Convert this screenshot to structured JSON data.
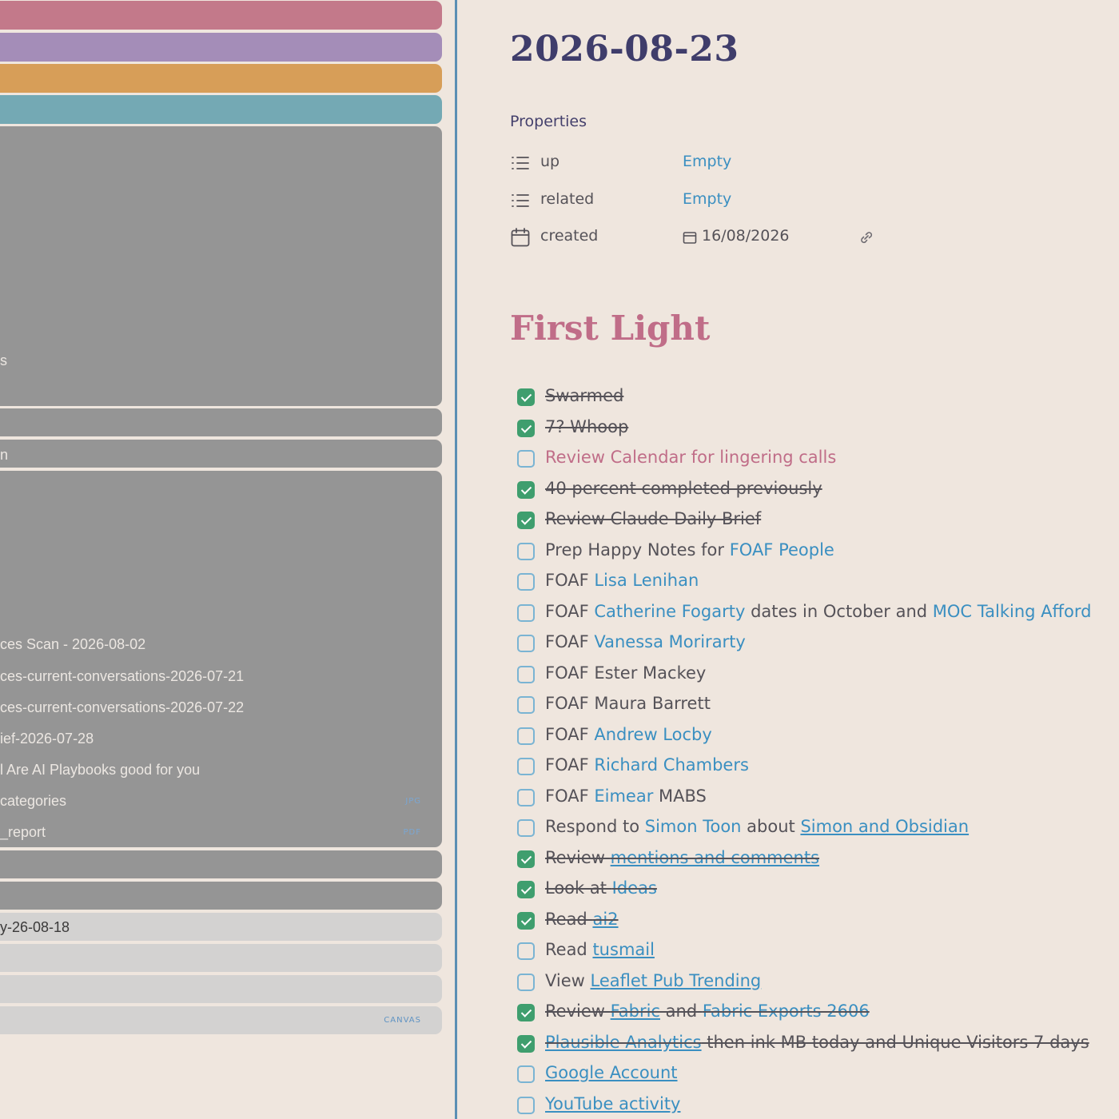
{
  "sidebar": {
    "colors": {
      "pink": "#c3798a",
      "purple": "#a48db8",
      "orange": "#d79e58",
      "teal": "#74a9b4",
      "grey": "#959595",
      "light_grey": "#d3d2d1"
    },
    "upper_group_fragment": "s",
    "middle_bar_fragment": "n",
    "recent_files": [
      {
        "label": "ces Scan - 2026-08-02",
        "tag": ""
      },
      {
        "label": "ces-current-conversations-2026-07-21",
        "tag": ""
      },
      {
        "label": "ces-current-conversations-2026-07-22",
        "tag": ""
      },
      {
        "label": "ief-2026-07-28",
        "tag": ""
      },
      {
        "label": "l  Are AI Playbooks good for you",
        "tag": ""
      },
      {
        "label": "categories",
        "tag": "JPG"
      },
      {
        "label": "_report",
        "tag": "PDF"
      }
    ],
    "light_rows": [
      {
        "label": "y-26-08-18",
        "tag": ""
      },
      {
        "label": "",
        "tag": ""
      },
      {
        "label": "",
        "tag": ""
      },
      {
        "label": "",
        "tag": "CANVAS"
      }
    ]
  },
  "note": {
    "title": "2026-08-23",
    "properties_heading": "Properties",
    "properties": [
      {
        "icon": "list-icon",
        "key": "up",
        "value": "Empty"
      },
      {
        "icon": "list-icon",
        "key": "related",
        "value": "Empty"
      },
      {
        "icon": "calendar-icon",
        "key": "created",
        "value": "16/08/2026"
      }
    ],
    "section_heading": "First Light",
    "tasks": [
      {
        "done": true,
        "parts": [
          {
            "t": "Swarmed",
            "s": "plain"
          }
        ]
      },
      {
        "done": true,
        "parts": [
          {
            "t": "7? Whoop",
            "s": "plain"
          }
        ]
      },
      {
        "done": false,
        "parts": [
          {
            "t": "Review Calendar for lingering calls",
            "s": "highlight"
          }
        ]
      },
      {
        "done": true,
        "parts": [
          {
            "t": "40 percent completed previously",
            "s": "plain"
          }
        ]
      },
      {
        "done": true,
        "parts": [
          {
            "t": "Review Claude Daily Brief",
            "s": "plain"
          }
        ]
      },
      {
        "done": false,
        "parts": [
          {
            "t": "Prep Happy Notes for ",
            "s": "plain"
          },
          {
            "t": "FOAF People",
            "s": "link"
          }
        ]
      },
      {
        "done": false,
        "parts": [
          {
            "t": "FOAF ",
            "s": "plain"
          },
          {
            "t": "Lisa Lenihan",
            "s": "link"
          }
        ]
      },
      {
        "done": false,
        "parts": [
          {
            "t": "FOAF ",
            "s": "plain"
          },
          {
            "t": "Catherine Fogarty",
            "s": "link"
          },
          {
            "t": " dates in October and ",
            "s": "plain"
          },
          {
            "t": "MOC Talking Afford",
            "s": "link"
          }
        ]
      },
      {
        "done": false,
        "parts": [
          {
            "t": "FOAF ",
            "s": "plain"
          },
          {
            "t": "Vanessa Morirarty",
            "s": "link"
          }
        ]
      },
      {
        "done": false,
        "parts": [
          {
            "t": "FOAF Ester Mackey",
            "s": "plain"
          }
        ]
      },
      {
        "done": false,
        "parts": [
          {
            "t": "FOAF Maura Barrett",
            "s": "plain"
          }
        ]
      },
      {
        "done": false,
        "parts": [
          {
            "t": "FOAF ",
            "s": "plain"
          },
          {
            "t": "Andrew Locby",
            "s": "link"
          }
        ]
      },
      {
        "done": false,
        "parts": [
          {
            "t": "FOAF ",
            "s": "plain"
          },
          {
            "t": "Richard Chambers",
            "s": "link"
          }
        ]
      },
      {
        "done": false,
        "parts": [
          {
            "t": "FOAF ",
            "s": "plain"
          },
          {
            "t": "Eimear",
            "s": "link"
          },
          {
            "t": " MABS",
            "s": "plain"
          }
        ]
      },
      {
        "done": false,
        "parts": [
          {
            "t": " Respond to ",
            "s": "plain"
          },
          {
            "t": "Simon Toon",
            "s": "link"
          },
          {
            "t": " about ",
            "s": "plain"
          },
          {
            "t": "Simon and Obsidian",
            "s": "ulink"
          }
        ]
      },
      {
        "done": true,
        "parts": [
          {
            "t": "Review ",
            "s": "plain"
          },
          {
            "t": "mentions and comments",
            "s": "ulink"
          }
        ]
      },
      {
        "done": true,
        "parts": [
          {
            "t": "Look at ",
            "s": "plain"
          },
          {
            "t": "Ideas",
            "s": "link"
          }
        ]
      },
      {
        "done": true,
        "parts": [
          {
            "t": "Read ",
            "s": "plain"
          },
          {
            "t": "ai2",
            "s": "ulink"
          }
        ]
      },
      {
        "done": false,
        "parts": [
          {
            "t": "Read ",
            "s": "plain"
          },
          {
            "t": "tusmail",
            "s": "ulink"
          }
        ]
      },
      {
        "done": false,
        "parts": [
          {
            "t": "View ",
            "s": "plain"
          },
          {
            "t": "Leaflet Pub Trending",
            "s": "ulink"
          }
        ]
      },
      {
        "done": true,
        "parts": [
          {
            "t": "Review ",
            "s": "plain"
          },
          {
            "t": "Fabric",
            "s": "ulink"
          },
          {
            "t": " and ",
            "s": "plain"
          },
          {
            "t": "Fabric Exports 2606",
            "s": "link"
          }
        ]
      },
      {
        "done": true,
        "parts": [
          {
            "t": "Plausible Analytics",
            "s": "ulink"
          },
          {
            "t": " then ink MB today and Unique Visitors 7 days",
            "s": "plain"
          }
        ]
      },
      {
        "done": false,
        "parts": [
          {
            "t": "Google Account",
            "s": "ulink"
          }
        ]
      },
      {
        "done": false,
        "parts": [
          {
            "t": "YouTube activity",
            "s": "ulink"
          }
        ]
      }
    ]
  }
}
